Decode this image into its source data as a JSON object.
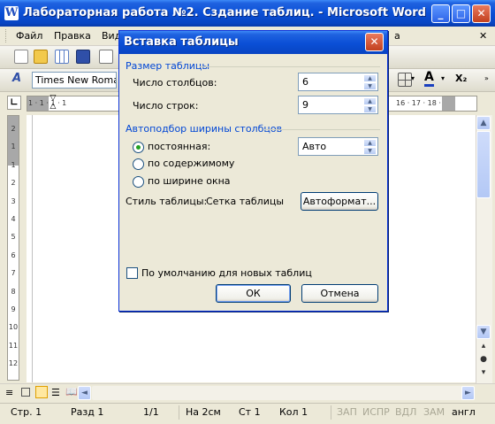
{
  "window": {
    "title": "Лабораторная работа №2. Сздание таблиц. - Microsoft Word",
    "word_icon": "W",
    "minimize_glyph": "_",
    "maximize_glyph": "□",
    "close_glyph": "✕"
  },
  "menu": {
    "file": "Файл",
    "edit": "Правка",
    "view_partial": "Вид",
    "table_partial": "а",
    "help_glyph": "✕"
  },
  "format_toolbar": {
    "font_name": "Times New Roman",
    "style_glyph": "A",
    "font_color_glyph": "A",
    "subscript_glyph": "X₂"
  },
  "ruler": {
    "left_numbers": "1 · 1 · 1 · 1",
    "right_numbers": "16 · 17 · 18 · 19"
  },
  "vertical_ruler": {
    "numbers": [
      "2",
      "1",
      "1",
      "2",
      "3",
      "4",
      "5",
      "6",
      "7",
      "8",
      "9",
      "10",
      "11",
      "12"
    ]
  },
  "dialog": {
    "title": "Вставка таблицы",
    "close_glyph": "✕",
    "size_group": "Размер таблицы",
    "columns_label": "Число столбцов:",
    "columns_value": "6",
    "rows_label": "Число строк:",
    "rows_value": "9",
    "autofit_group": "Автоподбор ширины столбцов",
    "radio_fixed": "постоянная:",
    "radio_fixed_selected": true,
    "fixed_width_value": "Авто",
    "radio_content": "по содержимому",
    "radio_window": "по ширине окна",
    "style_label": "Стиль таблицы:",
    "style_value": "Сетка таблицы",
    "autoformat_button": "Автоформат...",
    "default_checkbox": "По умолчанию для новых таблиц",
    "default_checked": false,
    "ok_button": "ОК",
    "cancel_button": "Отмена"
  },
  "statusbar": {
    "page": "Стр. 1",
    "section": "Разд 1",
    "pages": "1/1",
    "at": "На 2см",
    "line": "Ст 1",
    "col": "Кол 1",
    "rec": "ЗАП",
    "trk": "ИСПР",
    "ext": "ВДЛ",
    "ovr": "ЗАМ",
    "lang": "англ"
  },
  "colors": {
    "title_blue": "#0a4fd6",
    "group_label_blue": "#0046d5",
    "face": "#ece9d8"
  }
}
